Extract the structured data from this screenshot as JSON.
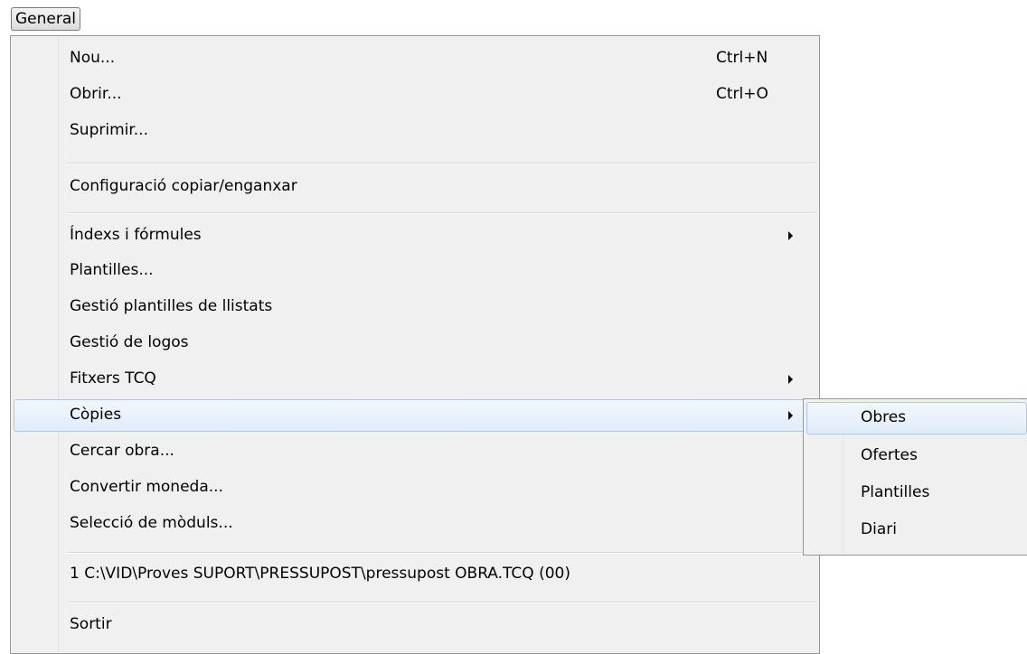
{
  "menubar": {
    "general_label": "General"
  },
  "menu": {
    "items": [
      {
        "label": "Nou...",
        "shortcut": "Ctrl+N"
      },
      {
        "label": "Obrir...",
        "shortcut": "Ctrl+O"
      },
      {
        "label": "Suprimir..."
      },
      {
        "label": "Configuració copiar/enganxar"
      },
      {
        "label": "Índexs i fórmules",
        "submenu_icon": "chevron-right-icon"
      },
      {
        "label": "Plantilles..."
      },
      {
        "label": "Gestió plantilles de llistats"
      },
      {
        "label": "Gestió de logos"
      },
      {
        "label": "Fitxers TCQ",
        "submenu_icon": "chevron-right-icon"
      },
      {
        "label": "Còpies",
        "submenu_icon": "chevron-right-icon",
        "highlighted": true
      },
      {
        "label": "Cercar obra..."
      },
      {
        "label": "Convertir moneda..."
      },
      {
        "label": "Selecció de mòduls..."
      },
      {
        "label": "1 C:\\VID\\Proves SUPORT\\PRESSUPOST\\pressupost OBRA.TCQ (00)"
      },
      {
        "label": "Sortir"
      }
    ]
  },
  "submenu": {
    "items": [
      {
        "label": "Obres",
        "highlighted": true
      },
      {
        "label": "Ofertes"
      },
      {
        "label": "Plantilles"
      },
      {
        "label": "Diari"
      }
    ]
  },
  "colors": {
    "menu_bg": "#f0f0f0",
    "highlight_border": "#a8c8ee",
    "highlight_bg": "#e1ecfa"
  }
}
